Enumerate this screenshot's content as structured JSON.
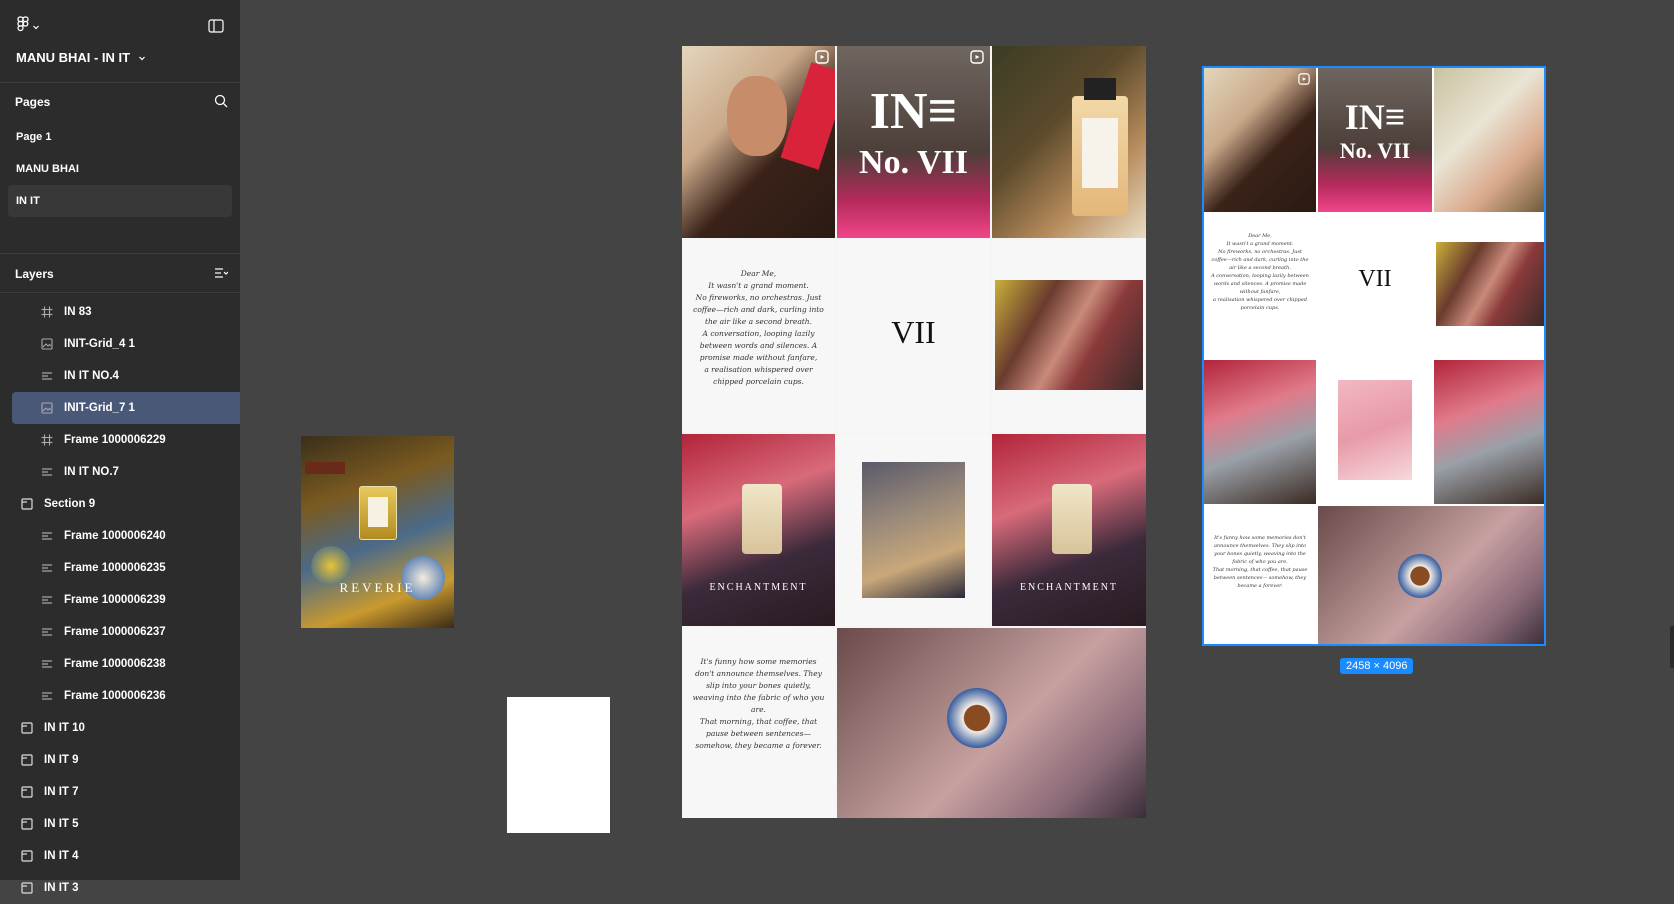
{
  "file": {
    "title": "MANU BHAI - IN IT"
  },
  "pages": {
    "header": "Pages",
    "items": [
      {
        "label": "Page 1"
      },
      {
        "label": "MANU BHAI"
      },
      {
        "label": "IN IT"
      }
    ]
  },
  "layers": {
    "header": "Layers",
    "items": [
      {
        "label": "IN 83",
        "icon": "frame-icon"
      },
      {
        "label": "INIT-Grid_4 1",
        "icon": "image-icon"
      },
      {
        "label": "IN IT NO.4",
        "icon": "text-frame-icon"
      },
      {
        "label": "INIT-Grid_7 1",
        "icon": "image-icon",
        "selected": true
      },
      {
        "label": "Frame 1000006229",
        "icon": "frame-icon"
      },
      {
        "label": "IN IT NO.7",
        "icon": "text-frame-icon"
      },
      {
        "label": "Section 9",
        "icon": "section-icon"
      },
      {
        "label": "Frame 1000006240",
        "icon": "text-frame-icon"
      },
      {
        "label": "Frame 1000006235",
        "icon": "text-frame-icon"
      },
      {
        "label": "Frame 1000006239",
        "icon": "text-frame-icon"
      },
      {
        "label": "Frame 1000006237",
        "icon": "text-frame-icon"
      },
      {
        "label": "Frame 1000006238",
        "icon": "text-frame-icon"
      },
      {
        "label": "Frame 1000006236",
        "icon": "text-frame-icon"
      },
      {
        "label": "IN IT 10",
        "icon": "section-icon"
      },
      {
        "label": "IN IT 9",
        "icon": "section-icon"
      },
      {
        "label": "IN IT 7",
        "icon": "section-icon"
      },
      {
        "label": "IN IT 5",
        "icon": "section-icon"
      },
      {
        "label": "IN IT 4",
        "icon": "section-icon"
      },
      {
        "label": "IN IT 3",
        "icon": "section-icon"
      }
    ]
  },
  "canvas": {
    "reverie": "REVERIE",
    "grid": {
      "logo_mark": "IN≡",
      "logo_number": "No. VII",
      "numeral": "VII",
      "enchantment": "ENCHANTMENT",
      "letter1": "Dear Me,\nIt wasn't a grand moment.\nNo fireworks, no orchestras. Just coffee—rich and dark, curling into the air like a second breath.\nA conversation, looping lazily between words and silences. A promise made without fanfare,\na realisation whispered over chipped porcelain cups.",
      "letter2": "It's funny how some memories don't announce themselves. They slip into your bones quietly, weaving into the fabric of who you are.\nThat morning, that coffee, that pause between sentences— somehow, they became a forever."
    },
    "selection_size": "2458 × 4096",
    "colors": {
      "selection": "#1a8cff",
      "selected_layer": "#4a5878"
    }
  }
}
